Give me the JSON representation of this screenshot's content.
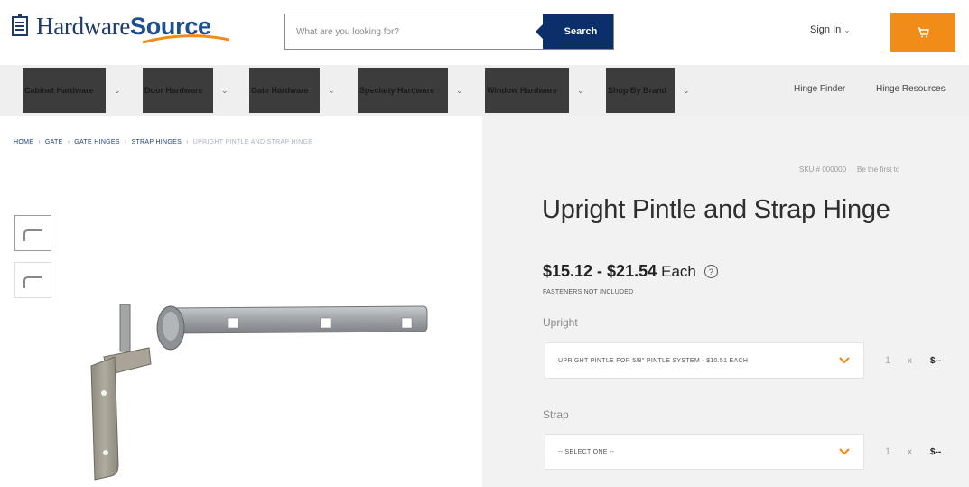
{
  "header": {
    "logo_part1": "Hardware",
    "logo_part2": "Source",
    "search_placeholder": "What are you looking for?",
    "search_button": "Search",
    "sign_in": "Sign In",
    "accent_color": "#f28c18",
    "brand_color": "#0a2f6b"
  },
  "nav": {
    "items": [
      {
        "label": "Cabinet Hardware"
      },
      {
        "label": "Door Hardware"
      },
      {
        "label": "Gate Hardware"
      },
      {
        "label": "Specialty Hardware"
      },
      {
        "label": "Window Hardware"
      },
      {
        "label": "Shop By Brand"
      }
    ],
    "links": [
      {
        "label": "Hinge Finder"
      },
      {
        "label": "Hinge Resources"
      }
    ]
  },
  "breadcrumb": {
    "items": [
      "HOME",
      "GATE",
      "GATE HINGES",
      "STRAP HINGES"
    ],
    "current": "UPRIGHT PINTLE AND STRAP HINGE"
  },
  "product": {
    "sku": "SKU # 000000",
    "reviews": "Be the first to",
    "title": "Upright Pintle and Strap Hinge",
    "price_range": "$15.12 - $21.54",
    "price_unit": "Each",
    "fasteners_note": "FASTENERS NOT INCLUDED",
    "options": [
      {
        "label": "Upright",
        "value": "UPRIGHT PINTLE FOR 5/8\" PINTLE SYSTEM - $10.51 EACH",
        "qty": "1",
        "times": "x",
        "line_price": "$--"
      },
      {
        "label": "Strap",
        "value": "-- SELECT ONE --",
        "qty": "1",
        "times": "x",
        "line_price": "$--"
      }
    ]
  },
  "icons": {
    "cart": "cart-icon",
    "info": "info-icon",
    "logo": "logo-icon",
    "chevron": "chevron-down-icon"
  }
}
